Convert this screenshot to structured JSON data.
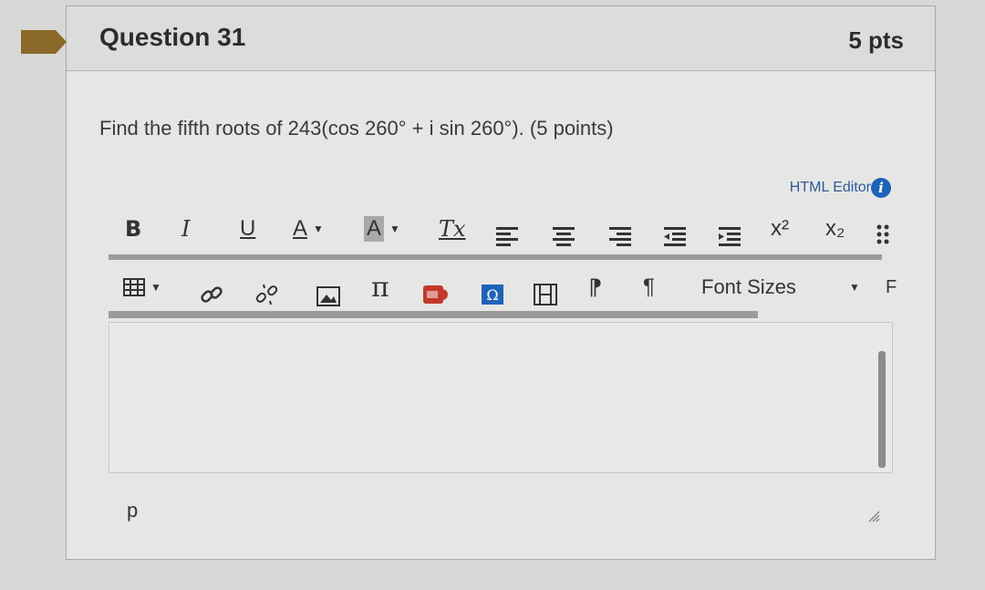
{
  "question": {
    "title": "Question 31",
    "points": "5 pts",
    "text": "Find the fifth roots of 243(cos 260° + i sin 260°). (5 points)"
  },
  "editor": {
    "html_editor_link": "HTML Editor",
    "info_icon_label": "i",
    "toolbar1": {
      "bold": "B",
      "italic": "I",
      "underline": "U",
      "text_color": "A",
      "bg_color": "A",
      "clear_format": "Tx",
      "superscript": "x²",
      "subscript": "x₂"
    },
    "toolbar2": {
      "font_sizes_label": "Font Sizes",
      "cutoff_label": "F"
    },
    "status_path": "p"
  },
  "colors": {
    "flag": "#8a6a2a",
    "link": "#2f5b9a",
    "info": "#1e63b8"
  }
}
